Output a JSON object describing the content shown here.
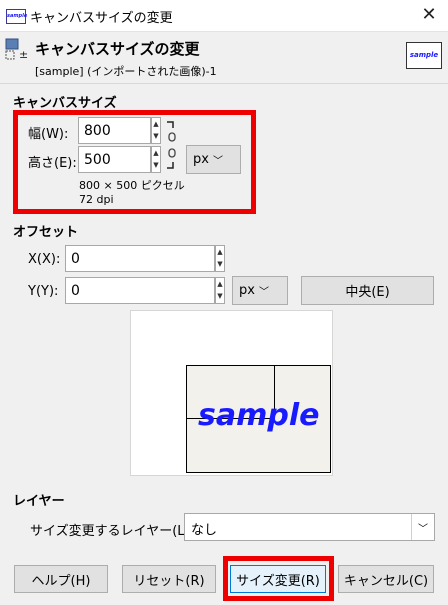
{
  "window": {
    "title": "キャンバスサイズの変更",
    "icon_text": "sample"
  },
  "header": {
    "title": "キャンバスサイズの変更",
    "subtitle": "[sample] (インポートされた画像)-1",
    "thumb_text": "sample"
  },
  "canvas_size": {
    "section_label": "キャンバスサイズ",
    "width_label": "幅(W):",
    "width_value": "800",
    "height_label": "高さ(E):",
    "height_value": "500",
    "unit": "px",
    "info_size": "800 × 500 ピクセル",
    "info_dpi": "72 dpi"
  },
  "offset": {
    "section_label": "オフセット",
    "x_label": "X(X):",
    "x_value": "0",
    "y_label": "Y(Y):",
    "y_value": "0",
    "unit": "px",
    "center_button": "中央(E)"
  },
  "preview": {
    "sample_text": "sample"
  },
  "layers": {
    "section_label": "レイヤー",
    "resize_label": "サイズ変更するレイヤー(L):",
    "resize_value": "なし"
  },
  "buttons": {
    "help": "ヘルプ(H)",
    "reset": "リセット(R)",
    "resize": "サイズ変更(R)",
    "cancel": "キャンセル(C)"
  },
  "colors": {
    "highlight": "#ee0000",
    "sample_text": "#1a1aff"
  }
}
